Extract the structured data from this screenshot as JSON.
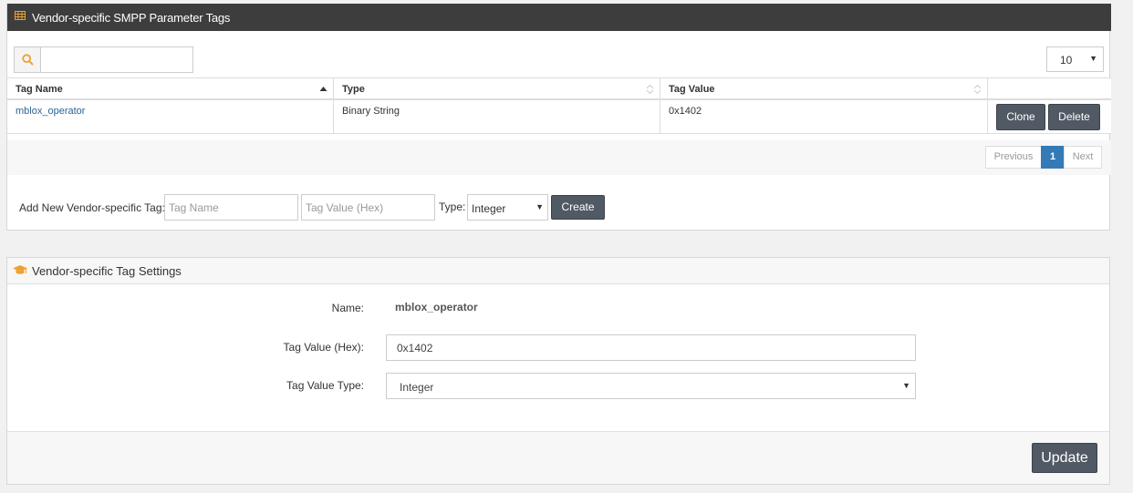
{
  "tags_panel": {
    "title": "Vendor-specific SMPP Parameter Tags",
    "header_icon": "table-icon",
    "search": {
      "icon": "search-icon",
      "value": "",
      "placeholder": ""
    },
    "page_size": "10",
    "columns": [
      {
        "label": "Tag Name",
        "sort": "ascending"
      },
      {
        "label": "Type",
        "sort": "none"
      },
      {
        "label": "Tag Value",
        "sort": "none"
      },
      {
        "label": "",
        "sort": "none"
      }
    ],
    "rows": [
      {
        "tag_name": "mblox_operator",
        "type": "Binary String",
        "tag_value": "0x1402",
        "clone_label": "Clone",
        "delete_label": "Delete"
      }
    ],
    "pagination": {
      "previous": "Previous",
      "current": "1",
      "next": "Next"
    },
    "add_form": {
      "label": "Add New Vendor-specific Tag:",
      "tag_name_placeholder": "Tag Name",
      "tag_value_placeholder": "Tag Value (Hex)",
      "type_label": "Type:",
      "type_selected": "Integer",
      "create_label": "Create"
    }
  },
  "settings_panel": {
    "title": "Vendor-specific Tag Settings",
    "header_icon": "graduation-cap-icon",
    "name_label": "Name:",
    "name_value": "mblox_operator",
    "hex_label": "Tag Value (Hex):",
    "hex_value": "0x1402",
    "type_label": "Tag Value Type:",
    "type_selected": "Integer",
    "update_label": "Update"
  },
  "colors": {
    "header_dark": "#3d3d3d",
    "accent_orange": "#f0a030",
    "button_dark": "#515964",
    "pager_active": "#337ab7",
    "link": "#2a6496"
  }
}
